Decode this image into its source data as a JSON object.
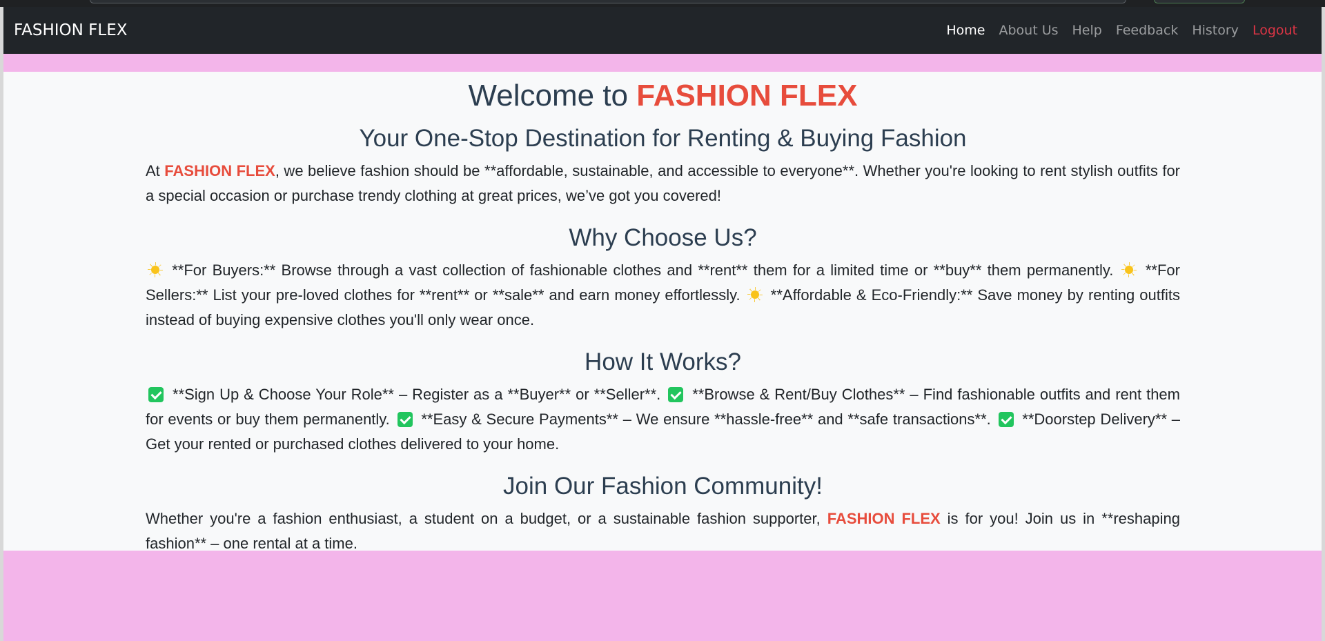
{
  "navbar": {
    "brand": "FASHION FLEX",
    "links": [
      {
        "label": "Home"
      },
      {
        "label": "About Us"
      },
      {
        "label": "Help"
      },
      {
        "label": "Feedback"
      },
      {
        "label": "History"
      },
      {
        "label": "Logout"
      }
    ]
  },
  "hero": {
    "title_prefix": "Welcome to ",
    "title_brand": "FASHION FLEX",
    "subtitle": "Your One-Stop Destination for Renting & Buying Fashion",
    "intro_before": "At ",
    "intro_brand": "FASHION FLEX",
    "intro_after": ", we believe fashion should be **affordable, sustainable, and accessible to everyone**. Whether you're looking to rent stylish outfits for a special occasion or purchase trendy clothing at great prices, we’ve got you covered!"
  },
  "why": {
    "heading": "Why Choose Us?",
    "items": [
      " **For Buyers:** Browse through a vast collection of fashionable clothes and **rent** them for a limited time or **buy** them permanently. ",
      " **For Sellers:** List your pre-loved clothes for **rent** or **sale** and earn money effortlessly. ",
      " **Affordable & Eco-Friendly:** Save money by renting outfits instead of buying expensive clothes you'll only wear once."
    ],
    "bullet_icon": "sun-icon"
  },
  "how": {
    "heading": "How It Works?",
    "steps": [
      " **Sign Up & Choose Your Role** – Register as a **Buyer** or **Seller**. ",
      " **Browse & Rent/Buy Clothes** – Find fashionable outfits and rent them for events or buy them permanently. ",
      " **Easy & Secure Payments** – We ensure **hassle-free** and **safe transactions**. ",
      " **Doorstep Delivery** – Get your rented or purchased clothes delivered to your home."
    ],
    "bullet_icon": "check-icon"
  },
  "community": {
    "heading": "Join Our Fashion Community!",
    "text_before": "Whether you're a fashion enthusiast, a student on a budget, or a sustainable fashion supporter, ",
    "text_brand": "FASHION FLEX",
    "text_after": " is for you! Join us in **reshaping fashion** – one rental at a time."
  },
  "colors": {
    "navbar_bg": "#212529",
    "page_bg": "#f3b5ea",
    "content_bg": "#f8f9fa",
    "brand_red": "#e74c3c",
    "heading": "#2c3e50",
    "logout": "#dc3545"
  }
}
